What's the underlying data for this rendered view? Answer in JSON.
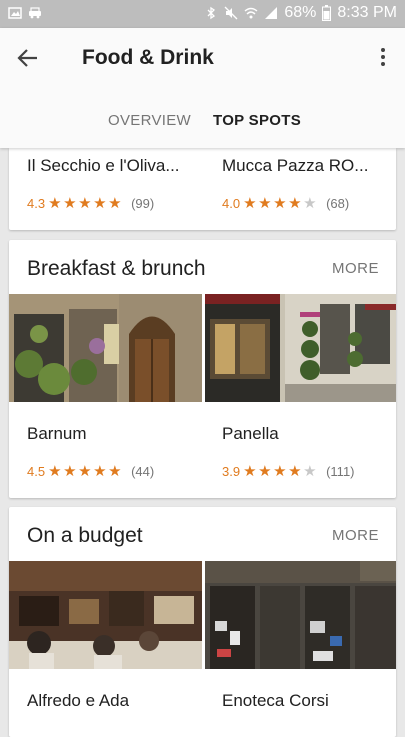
{
  "status_bar": {
    "battery": "68%",
    "time": "8:33 PM"
  },
  "header": {
    "title": "Food & Drink",
    "tabs": [
      {
        "label": "OVERVIEW",
        "selected": false
      },
      {
        "label": "TOP SPOTS",
        "selected": true
      }
    ],
    "accent_color": "#4caf7d"
  },
  "rating_color": "#e07b1f",
  "card_previous": {
    "places": [
      {
        "name": "Il Secchio e l'Oliva...",
        "rating": "4.3",
        "stars": 5,
        "reviews": "(99)"
      },
      {
        "name": "Mucca Pazza RO...",
        "rating": "4.0",
        "stars": 4,
        "reviews": "(68)"
      }
    ]
  },
  "card_breakfast": {
    "title": "Breakfast & brunch",
    "more_label": "MORE",
    "places": [
      {
        "name": "Barnum",
        "rating": "4.5",
        "stars": 5,
        "reviews": "(44)"
      },
      {
        "name": "Panella",
        "rating": "3.9",
        "stars": 4,
        "reviews": "(111)"
      }
    ]
  },
  "card_budget": {
    "title": "On a budget",
    "more_label": "MORE",
    "places": [
      {
        "name": "Alfredo e Ada"
      },
      {
        "name": "Enoteca Corsi"
      }
    ]
  }
}
